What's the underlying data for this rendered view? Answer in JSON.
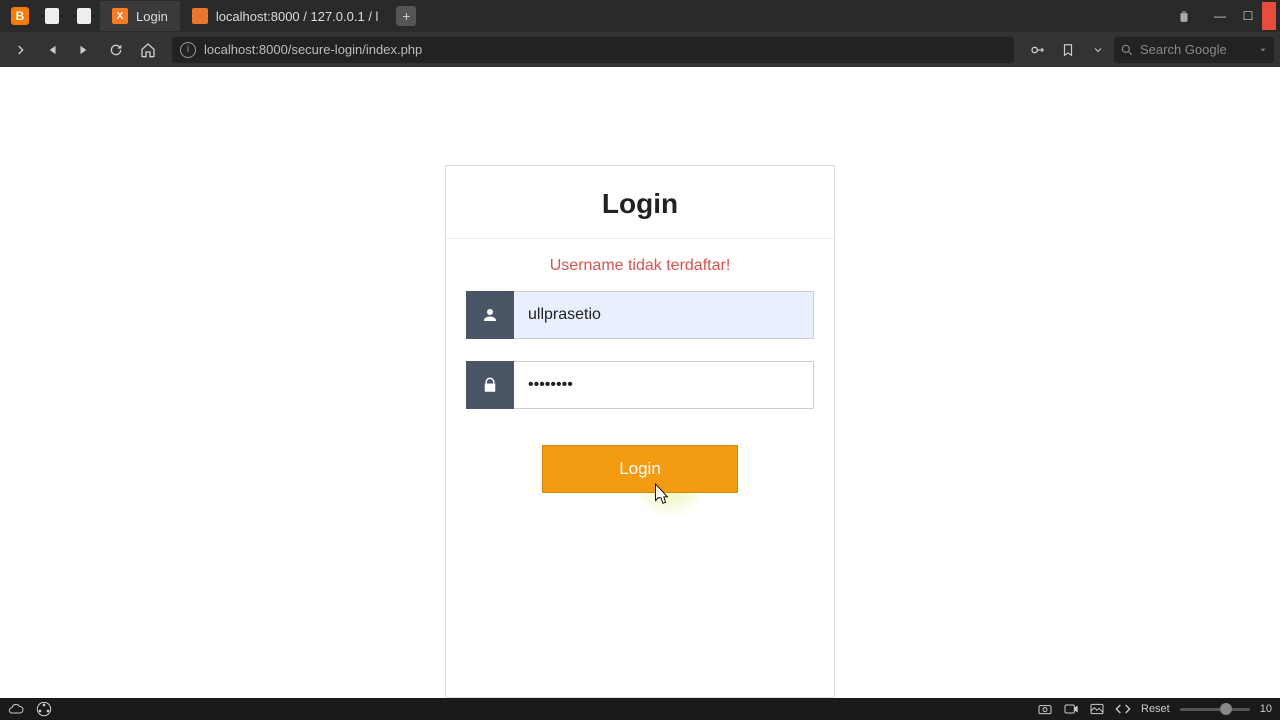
{
  "tabs": [
    {
      "label": "",
      "icon": "blogger"
    },
    {
      "label": "",
      "icon": "doc"
    },
    {
      "label": "",
      "icon": "doc"
    },
    {
      "label": "Login",
      "icon": "xampp",
      "active": true
    },
    {
      "label": "localhost:8000 / 127.0.0.1 / l",
      "icon": "pma"
    }
  ],
  "url": "localhost:8000/secure-login/index.php",
  "search_placeholder": "Search Google",
  "login": {
    "title": "Login",
    "error": "Username tidak terdaftar!",
    "username_value": "ullprasetio",
    "password_value": "••••••••",
    "button_label": "Login"
  },
  "taskbar": {
    "reset": "Reset",
    "zoom": "10"
  }
}
